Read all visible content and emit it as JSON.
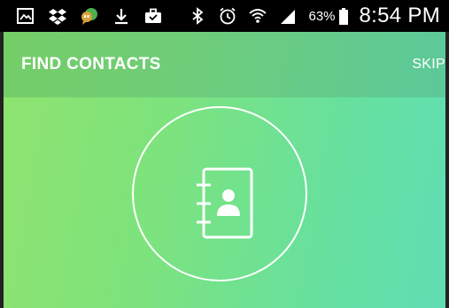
{
  "status_bar": {
    "icons_left": [
      "gallery-icon",
      "dropbox-icon",
      "hangouts-icon",
      "download-icon",
      "briefcase-icon"
    ],
    "icons_right": [
      "bluetooth-icon",
      "alarm-icon",
      "wifi-icon",
      "signal-icon"
    ],
    "battery_percent": "63%",
    "time": "8:54 PM"
  },
  "app_bar": {
    "title": "FIND CONTACTS",
    "skip_label": "SKIP"
  },
  "main": {
    "illustration_icon": "contacts-book-icon"
  },
  "colors": {
    "gradient_start": "#8fe36f",
    "gradient_end": "#5fdeb3",
    "status_bar": "#000000",
    "text": "#ffffff"
  }
}
